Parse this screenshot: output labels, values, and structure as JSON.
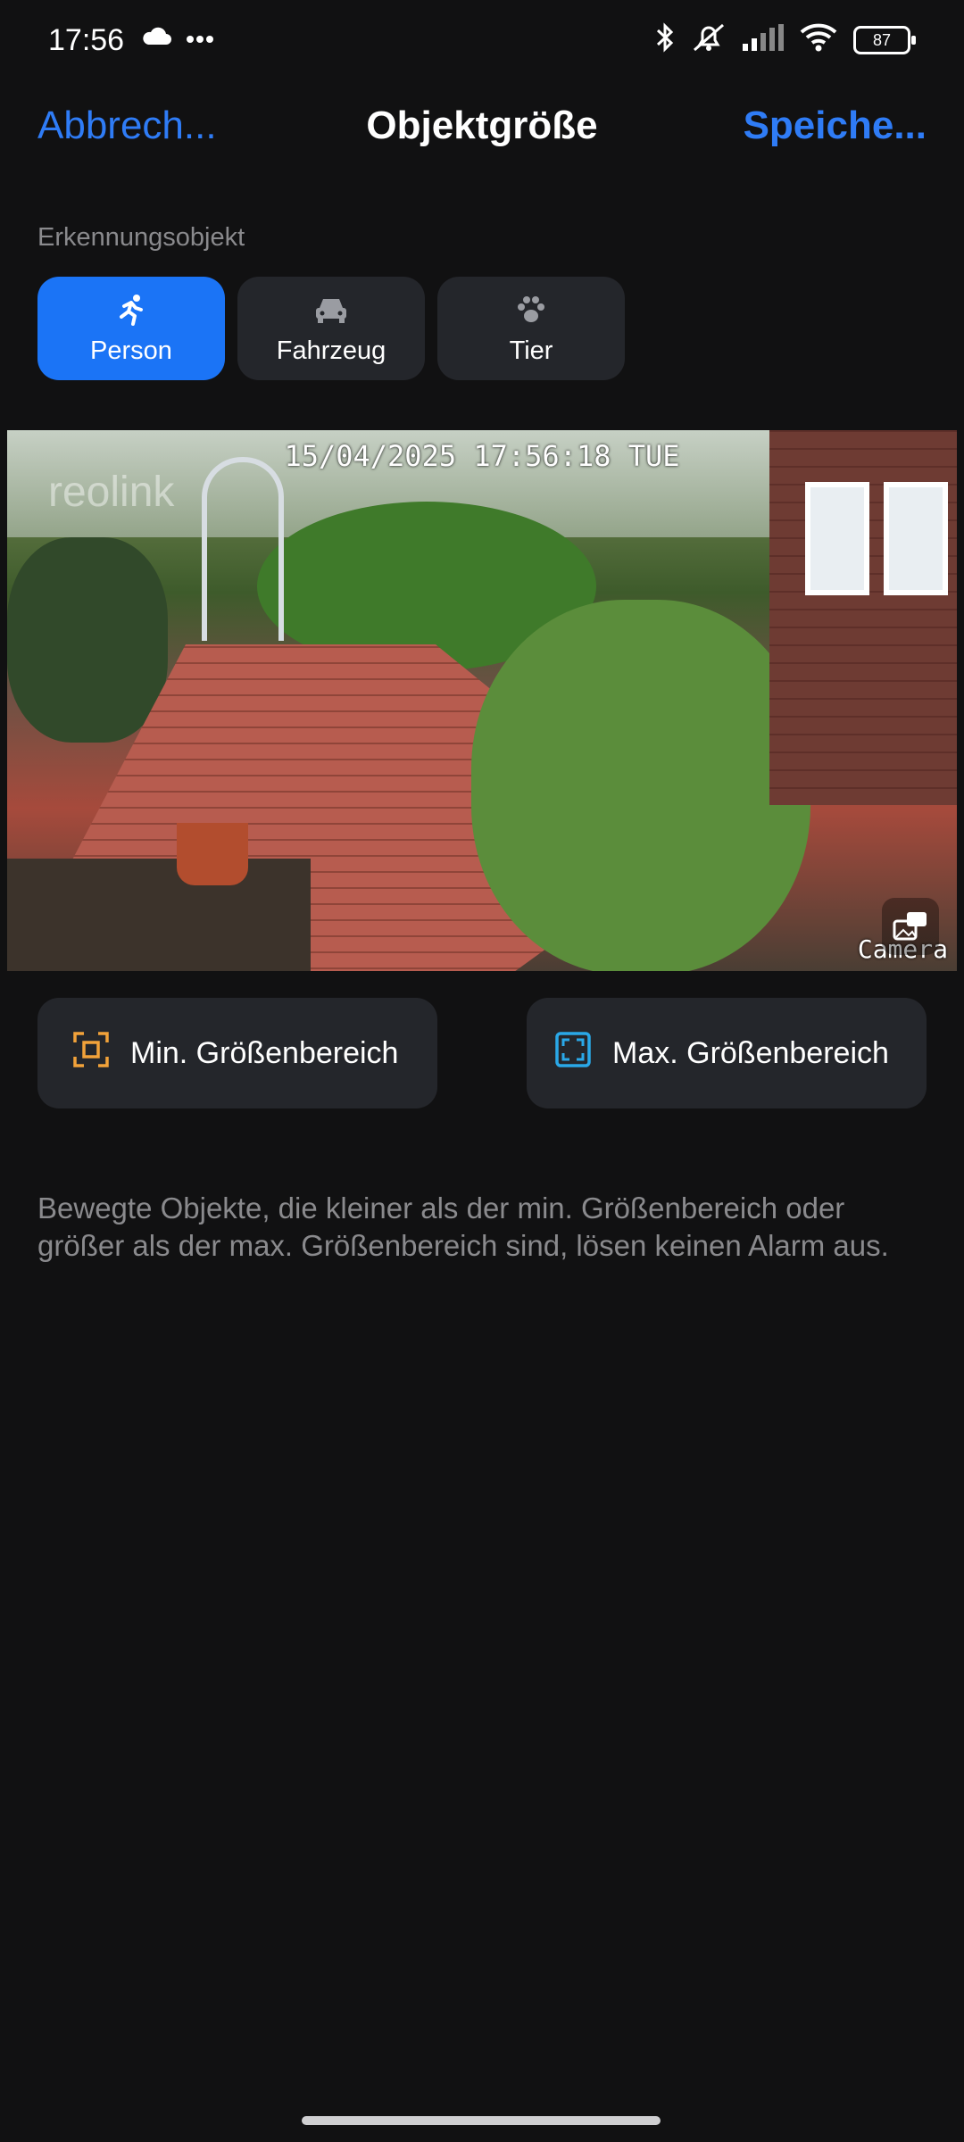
{
  "status_bar": {
    "time": "17:56",
    "battery": "87",
    "icons": [
      "cloud-icon",
      "more-icon",
      "bluetooth-icon",
      "muted-bell-icon",
      "signal-icon",
      "wifi-icon",
      "battery-icon"
    ]
  },
  "header": {
    "cancel_label": "Abbrech...",
    "title": "Objektgröße",
    "save_label": "Speiche..."
  },
  "section_label": "Erkennungsobjekt",
  "detection_chips": [
    {
      "label": "Person",
      "icon": "running-person-icon",
      "selected": true
    },
    {
      "label": "Fahrzeug",
      "icon": "car-icon",
      "selected": false
    },
    {
      "label": "Tier",
      "icon": "paw-icon",
      "selected": false
    }
  ],
  "camera": {
    "timestamp": "15/04/2025 17:56:18 TUE",
    "watermark": "reolink",
    "label": "Camera",
    "toggle_icon": "picture-in-picture-icon"
  },
  "size_buttons": {
    "min_label": "Min. Größenbereich",
    "max_label": "Max. Größenbereich"
  },
  "help_text": "Bewegte Objekte, die kleiner als der min. Größenbereich oder größer als der max. Größenbereich sind, lösen keinen Alarm aus.",
  "colors": {
    "accent": "#1b74f6",
    "link": "#2f7cf6",
    "min_icon": "#f2a23a",
    "max_icon": "#2aa8e8"
  }
}
